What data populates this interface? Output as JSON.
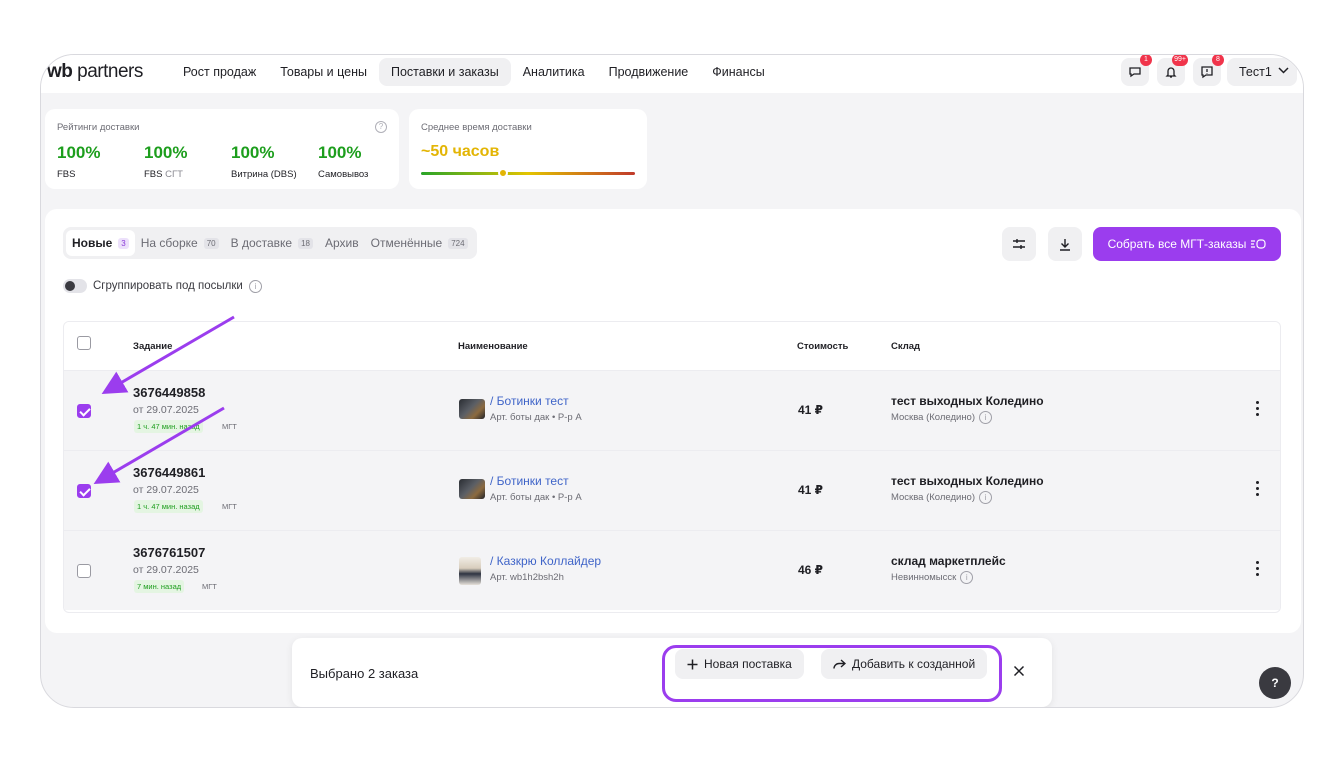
{
  "header": {
    "logo_wb": "wb",
    "logo_text": "partners",
    "nav": [
      "Рост продаж",
      "Товары и цены",
      "Поставки и заказы",
      "Аналитика",
      "Продвижение",
      "Финансы"
    ],
    "active_nav": "Поставки и заказы",
    "badges": {
      "chat": "1",
      "notifications": "99+",
      "support": "8"
    },
    "user": "Тест1"
  },
  "ratings": {
    "title": "Рейтинги доставки",
    "items": [
      {
        "value": "100%",
        "label": "FBS",
        "label_suffix": ""
      },
      {
        "value": "100%",
        "label": "FBS",
        "label_suffix": "СГТ"
      },
      {
        "value": "100%",
        "label": "Витрина (DBS)",
        "label_suffix": ""
      },
      {
        "value": "100%",
        "label": "Самовывоз",
        "label_suffix": ""
      }
    ]
  },
  "delivery_time": {
    "title": "Среднее время доставки",
    "value": "~50 часов",
    "indicator_fraction": 0.42
  },
  "tabs": [
    {
      "label": "Новые",
      "count": "3",
      "active": true
    },
    {
      "label": "На сборке",
      "count": "70",
      "active": false
    },
    {
      "label": "В доставке",
      "count": "18",
      "active": false
    },
    {
      "label": "Архив",
      "count": "",
      "active": false
    },
    {
      "label": "Отменённые",
      "count": "724",
      "active": false
    }
  ],
  "collect_button": "Собрать все МГТ-заказы",
  "group_toggle_label": "Сгруппировать под посылки",
  "table": {
    "headers": {
      "task": "Задание",
      "name": "Наименование",
      "price": "Стоимость",
      "warehouse": "Склад"
    },
    "rows": [
      {
        "id": "3676449858",
        "date": "от 29.07.2025",
        "time": "1 ч. 47 мин. назад",
        "tag": "МГТ",
        "product": "/ Ботинки тест",
        "article": "Арт. боты дак • Р-р А",
        "price": "41 ₽",
        "warehouse": "тест выходных Коледино",
        "city": "Москва (Коледино)",
        "checked": true
      },
      {
        "id": "3676449861",
        "date": "от 29.07.2025",
        "time": "1 ч. 47 мин. назад",
        "tag": "МГТ",
        "product": "/ Ботинки тест",
        "article": "Арт. боты дак • Р-р А",
        "price": "41 ₽",
        "warehouse": "тест выходных Коледино",
        "city": "Москва (Коледино)",
        "checked": true
      },
      {
        "id": "3676761507",
        "date": "от 29.07.2025",
        "time": "7 мин. назад",
        "tag": "МГТ",
        "product": "/ Казкрю Коллайдер",
        "article": "Арт. wb1h2bsh2h",
        "price": "46 ₽",
        "warehouse": "склад маркетплейс",
        "city": "Невинномысск",
        "checked": false
      }
    ]
  },
  "bottom_bar": {
    "selected": "Выбрано 2 заказа",
    "new_supply": "Новая поставка",
    "add_to_existing": "Добавить к созданной"
  },
  "help_label": "?",
  "colors": {
    "accent": "#9b3dee",
    "green": "#1d9e1d",
    "link": "#3f64c8",
    "warning": "#e3b505"
  }
}
